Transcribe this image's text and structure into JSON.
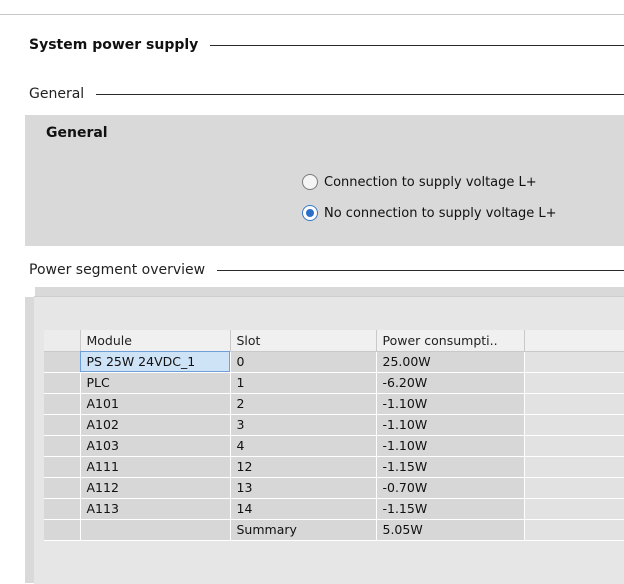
{
  "sections": {
    "system_power_supply": "System power supply",
    "general": "General",
    "power_segment_overview": "Power segment overview"
  },
  "general_panel": {
    "heading": "General",
    "options": [
      {
        "label": "Connection to supply voltage L+",
        "selected": false
      },
      {
        "label": "No connection to supply voltage L+",
        "selected": true
      }
    ]
  },
  "table": {
    "columns": [
      "Module",
      "Slot",
      "Power consumpti.."
    ],
    "rows": [
      {
        "module": "PS 25W 24VDC_1",
        "slot": "0",
        "power": "25.00W"
      },
      {
        "module": "PLC",
        "slot": "1",
        "power": "-6.20W"
      },
      {
        "module": "A101",
        "slot": "2",
        "power": "-1.10W"
      },
      {
        "module": "A102",
        "slot": "3",
        "power": "-1.10W"
      },
      {
        "module": "A103",
        "slot": "4",
        "power": "-1.10W"
      },
      {
        "module": "A111",
        "slot": "12",
        "power": "-1.15W"
      },
      {
        "module": "A112",
        "slot": "13",
        "power": "-0.70W"
      },
      {
        "module": "A113",
        "slot": "14",
        "power": "-1.15W"
      },
      {
        "module": "",
        "slot": "Summary",
        "power": "5.05W"
      }
    ]
  }
}
